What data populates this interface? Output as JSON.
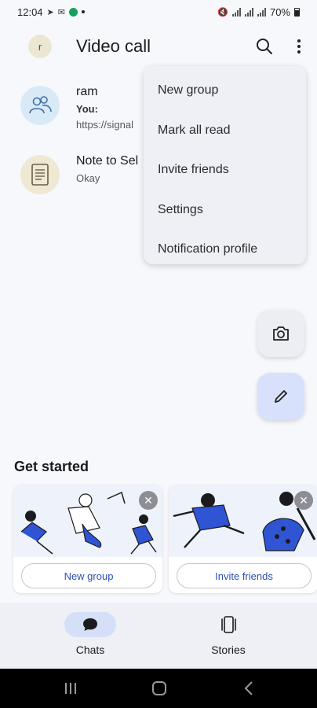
{
  "status_bar": {
    "time": "12:04",
    "battery": "70%"
  },
  "header": {
    "avatar_initial": "r",
    "title": "Video call"
  },
  "chats": [
    {
      "name": "ram",
      "sender": "You:",
      "preview": "https://signal",
      "avatar": "group-avatar-icon"
    },
    {
      "name": "Note to Sel",
      "preview": "Okay",
      "avatar": "note-avatar-icon"
    }
  ],
  "menu": {
    "items": [
      "New group",
      "Mark all read",
      "Invite friends",
      "Settings",
      "Notification profile"
    ]
  },
  "get_started": {
    "title": "Get started",
    "cards": [
      {
        "button": "New group"
      },
      {
        "button": "Invite friends"
      }
    ]
  },
  "bottom_nav": {
    "items": [
      {
        "label": "Chats",
        "icon": "chat-bubble-icon",
        "active": true
      },
      {
        "label": "Stories",
        "icon": "stories-icon",
        "active": false
      }
    ]
  },
  "colors": {
    "accent": "#2c4fb3",
    "illustration_blue": "#2f55d4",
    "menu_bg": "#eef0f5",
    "fab_compose_bg": "#d7e1fb"
  }
}
